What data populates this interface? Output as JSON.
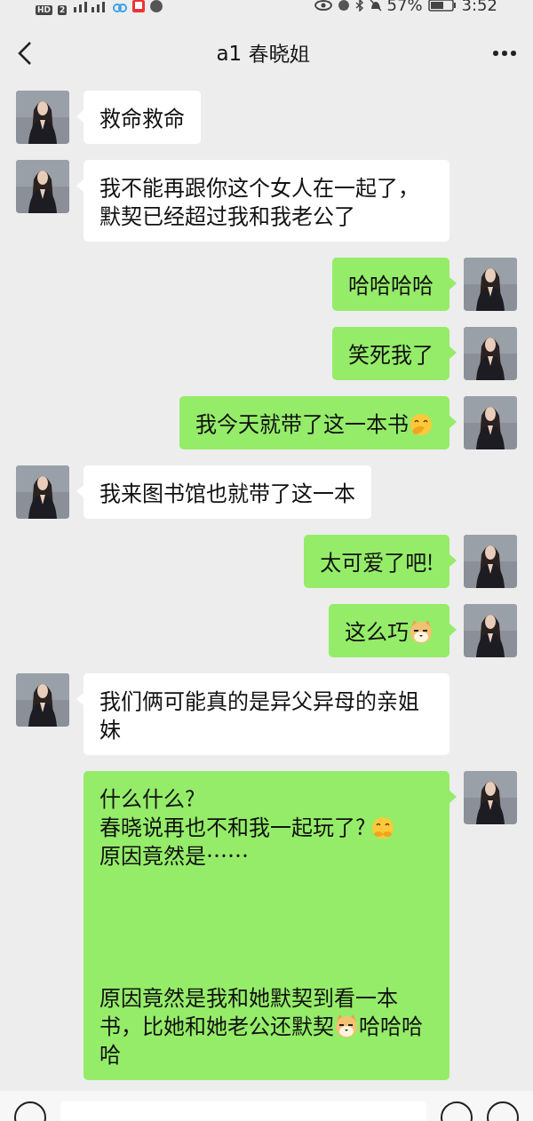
{
  "status_bar": {
    "network_badge": "HD",
    "sim_slot": "2",
    "battery": "57%",
    "time": "3:52"
  },
  "header": {
    "title": "a1 春晓姐"
  },
  "messages": [
    {
      "outgoing": false,
      "blocks": [
        {
          "kind": "text",
          "segments": [
            {
              "kind": "text",
              "text": "救命救命"
            }
          ]
        }
      ]
    },
    {
      "outgoing": false,
      "blocks": [
        {
          "kind": "text",
          "segments": [
            {
              "kind": "text",
              "text": "我不能再跟你这个女人在一起了，默契已经超过我和我老公了"
            }
          ]
        }
      ]
    },
    {
      "outgoing": true,
      "blocks": [
        {
          "kind": "text",
          "segments": [
            {
              "kind": "text",
              "text": "哈哈哈哈"
            }
          ]
        }
      ]
    },
    {
      "outgoing": true,
      "blocks": [
        {
          "kind": "text",
          "segments": [
            {
              "kind": "text",
              "text": "笑死我了"
            }
          ]
        }
      ]
    },
    {
      "outgoing": true,
      "blocks": [
        {
          "kind": "text",
          "segments": [
            {
              "kind": "text",
              "text": "我今天就带了这一本书"
            },
            {
              "kind": "giggle"
            }
          ]
        }
      ]
    },
    {
      "outgoing": false,
      "blocks": [
        {
          "kind": "text",
          "segments": [
            {
              "kind": "text",
              "text": "我来图书馆也就带了这一本"
            }
          ]
        }
      ]
    },
    {
      "outgoing": true,
      "blocks": [
        {
          "kind": "text",
          "segments": [
            {
              "kind": "text",
              "text": "太可爱了吧!"
            }
          ]
        }
      ]
    },
    {
      "outgoing": true,
      "blocks": [
        {
          "kind": "text",
          "segments": [
            {
              "kind": "text",
              "text": "这么巧"
            },
            {
              "kind": "doge"
            }
          ]
        }
      ]
    },
    {
      "outgoing": false,
      "blocks": [
        {
          "kind": "text",
          "segments": [
            {
              "kind": "text",
              "text": "我们俩可能真的是异父异母的亲姐妹"
            }
          ]
        }
      ]
    },
    {
      "outgoing": true,
      "blocks": [
        {
          "kind": "text",
          "segments": [
            {
              "kind": "text",
              "text": "什么什么?"
            }
          ]
        },
        {
          "kind": "text",
          "segments": [
            {
              "kind": "text",
              "text": "春晓说再也不和我一起玩了? "
            },
            {
              "kind": "shy"
            }
          ]
        },
        {
          "kind": "text",
          "segments": [
            {
              "kind": "text",
              "text": "原因竟然是……"
            }
          ]
        },
        {
          "kind": "blank"
        },
        {
          "kind": "blank"
        },
        {
          "kind": "blank"
        },
        {
          "kind": "blank"
        },
        {
          "kind": "text",
          "segments": [
            {
              "kind": "text",
              "text": "原因竟然是我和她默契到看一本书，比她和她老公还默契"
            },
            {
              "kind": "doge"
            },
            {
              "kind": "text",
              "text": "哈哈哈哈"
            }
          ]
        }
      ]
    }
  ]
}
